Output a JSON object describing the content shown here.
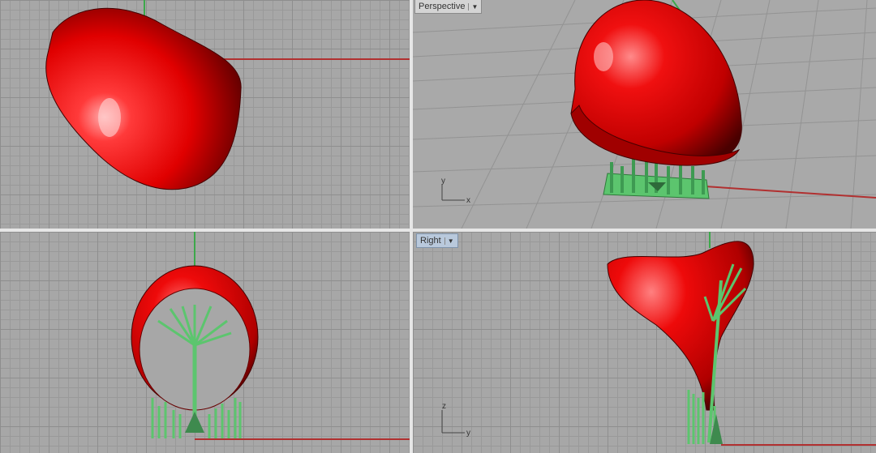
{
  "viewports": {
    "perspective": {
      "label": "Perspective",
      "menu_icon": "chevron-down-icon"
    },
    "right": {
      "label": "Right",
      "menu_icon": "chevron-down-icon"
    }
  },
  "axes": {
    "perspective": {
      "x": "x",
      "y": "y"
    },
    "right": {
      "z": "z",
      "y": "y"
    }
  },
  "colors": {
    "model_red": "#e00000",
    "support_green": "#5cc56e",
    "grid_bg": "#a7a7a7",
    "grid_line": "#8e8e8e",
    "x_axis_red": "#b13030",
    "y_axis_green": "#3da84b"
  }
}
